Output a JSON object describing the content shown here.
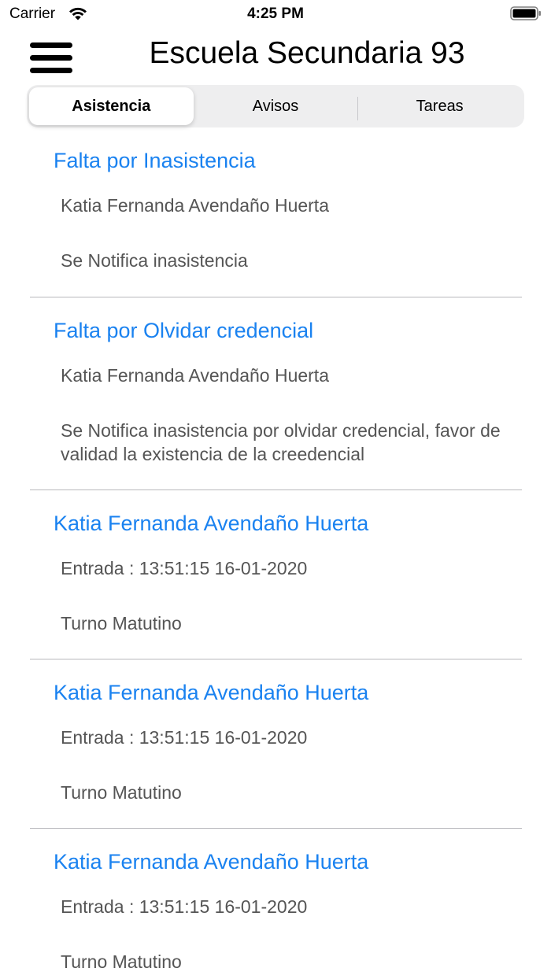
{
  "status_bar": {
    "carrier": "Carrier",
    "time": "4:25 PM",
    "wifi_icon": "wifi-icon",
    "battery_icon": "battery-icon"
  },
  "header": {
    "menu_icon": "hamburger-menu-icon",
    "title": "Escuela Secundaria 93"
  },
  "tabs": [
    {
      "label": "Asistencia",
      "selected": true
    },
    {
      "label": "Avisos",
      "selected": false
    },
    {
      "label": "Tareas",
      "selected": false
    }
  ],
  "items": [
    {
      "title": "Falta por Inasistencia",
      "line1": "Katia Fernanda Avendaño Huerta",
      "line2": "Se Notifica inasistencia"
    },
    {
      "title": "Falta por Olvidar credencial",
      "line1": "Katia Fernanda Avendaño Huerta",
      "line2": "Se Notifica inasistencia por olvidar credencial, favor de validad la existencia de la creedencial"
    },
    {
      "title": "Katia Fernanda Avendaño Huerta",
      "line1": "Entrada : 13:51:15 16-01-2020",
      "line2": "Turno Matutino"
    },
    {
      "title": "Katia Fernanda Avendaño Huerta",
      "line1": "Entrada : 13:51:15 16-01-2020",
      "line2": "Turno Matutino"
    },
    {
      "title": "Katia Fernanda Avendaño Huerta",
      "line1": "Entrada : 13:51:15 16-01-2020",
      "line2": "Turno Matutino"
    }
  ],
  "colors": {
    "accent": "#1a82f0",
    "secondary_text": "#555555",
    "segment_bg": "#eeeeef"
  }
}
